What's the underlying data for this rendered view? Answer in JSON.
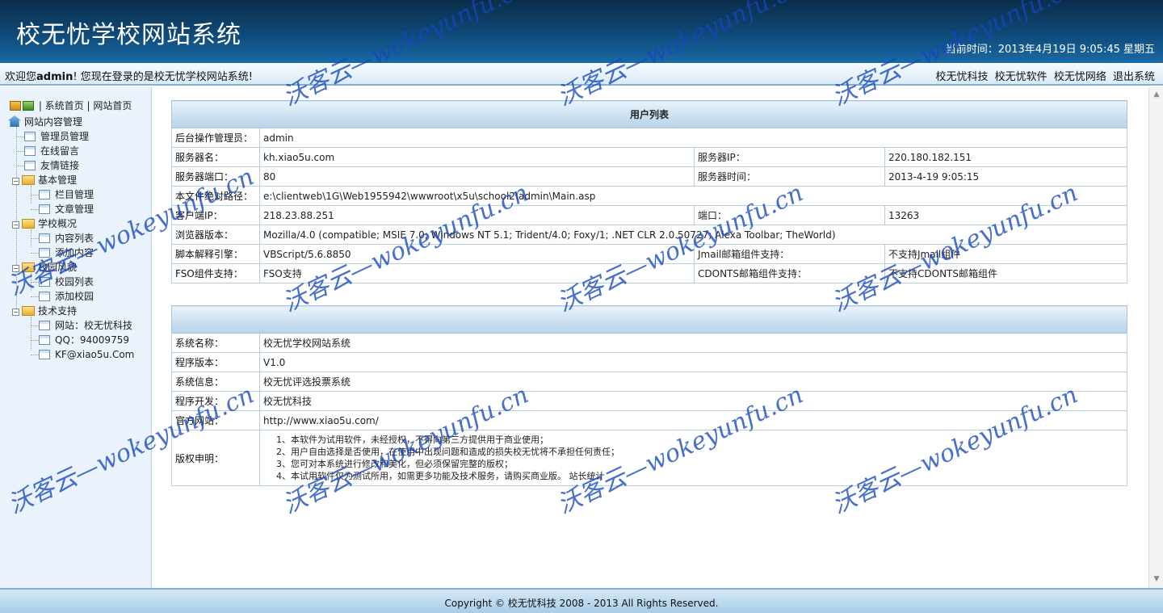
{
  "header": {
    "title": "校无忧学校网站系统",
    "clock": "当前时间：2013年4月19日  9:05:45 星期五"
  },
  "welcome": {
    "prefix": "欢迎您",
    "user": "admin",
    "suffix": "! 您现在登录的是校无忧学校网站系统!"
  },
  "top_links": [
    "校无忧科技",
    "校无忧软件",
    "校无忧网络",
    "退出系统"
  ],
  "sidebar": {
    "top_links": [
      "系统首页",
      "网站首页"
    ],
    "root": "网站内容管理",
    "items": [
      {
        "label": "管理员管理"
      },
      {
        "label": "在线留言"
      },
      {
        "label": "友情链接"
      }
    ],
    "groups": [
      {
        "label": "基本管理",
        "children": [
          "栏目管理",
          "文章管理"
        ]
      },
      {
        "label": "学校概况",
        "children": [
          "内容列表",
          "添加内容"
        ]
      },
      {
        "label": "校园风貌",
        "children": [
          "校园列表",
          "添加校园"
        ]
      },
      {
        "label": "技术支持",
        "children": [
          "网站：校无忧科技",
          "QQ：94009759",
          "KF@xiao5u.Com"
        ]
      }
    ]
  },
  "server_table": {
    "title": "用户列表",
    "admin_label": "后台操作管理员：",
    "admin_value": "admin",
    "server_name_label": "服务器名：",
    "server_name_value": "kh.xiao5u.com",
    "server_ip_label": "服务器IP：",
    "server_ip_value": "220.180.182.151",
    "server_port_label": "服务器端口：",
    "server_port_value": "80",
    "server_time_label": "服务器时间：",
    "server_time_value": "2013-4-19 9:05:15",
    "path_label": "本文件绝对路径：",
    "path_value": "e:\\clientweb\\1G\\Web1955942\\wwwroot\\x5u\\school2\\admin\\Main.asp",
    "client_ip_label": "客户端IP：",
    "client_ip_value": "218.23.88.251",
    "port_label": "端口：",
    "port_value": "13263",
    "browser_label": "浏览器版本：",
    "browser_value": "Mozilla/4.0 (compatible; MSIE 7.0; Windows NT 5.1; Trident/4.0; Foxy/1; .NET CLR 2.0.50727; Alexa Toolbar; TheWorld)",
    "script_label": "脚本解释引擎：",
    "script_value": "VBScript/5.6.8850",
    "jmail_label": "Jmail邮箱组件支持：",
    "jmail_value": "不支持Jmail组件",
    "fso_label": "FSO组件支持：",
    "fso_value": "FSO支持",
    "cdonts_label": "CDONTS邮箱组件支持：",
    "cdonts_value": "不支持CDONTS邮箱组件"
  },
  "system_table": {
    "name_label": "系统名称：",
    "name_value": "校无忧学校网站系统",
    "version_label": "程序版本：",
    "version_value": "V1.0",
    "info_label": "系统信息：",
    "info_value": "校无忧评选投票系统",
    "dev_label": "程序开发：",
    "dev_value": "校无忧科技",
    "site_label": "官方网站：",
    "site_value": "http://www.xiao5u.com/",
    "copyright_label": "版权申明：",
    "copyright_lines": [
      "1、本软件为试用软件，未经授权，不得向第三方提供用于商业使用；",
      "2、用户自由选择是否使用，在使用中出现问题和造成的损失校无忧将不承担任何责任；",
      "3、您可对本系统进行修改和美化，但必须保留完整的版权；",
      "4、本试用软件仅为测试所用，如需更多功能及技术服务，请购买商业版。 站长统计"
    ]
  },
  "footer": {
    "copyright": "Copyright © 校无忧科技  2008 - 2013 All Rights Reserved."
  },
  "watermark": "沃客云—wokeyunfu.cn"
}
